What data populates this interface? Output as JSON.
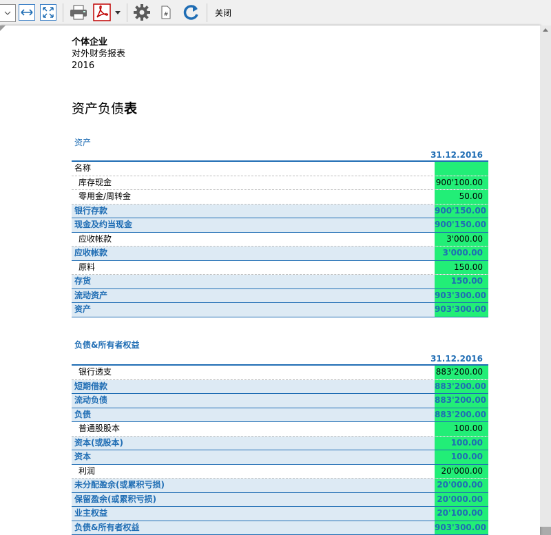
{
  "toolbar": {
    "close_label": "关闭"
  },
  "report": {
    "company": "个体企业",
    "subtitle": "对外财务报表",
    "year": "2016",
    "title_part1": "资产负债",
    "title_part2": "表"
  },
  "assets": {
    "section_label": "资产",
    "date": "31.12.2016",
    "rows": [
      {
        "label": "名称",
        "value": "",
        "kind": "head"
      },
      {
        "label": "库存现金",
        "value": "900'100.00",
        "kind": "sub"
      },
      {
        "label": "零用金/周转金",
        "value": "50.00",
        "kind": "sub"
      },
      {
        "label": "银行存款",
        "value": "900'150.00",
        "kind": "total"
      },
      {
        "label": "现金及约当现金",
        "value": "900'150.00",
        "kind": "total"
      },
      {
        "label": "应收帐款",
        "value": "3'000.00",
        "kind": "sub"
      },
      {
        "label": "应收帐款",
        "value": "3'000.00",
        "kind": "total"
      },
      {
        "label": "原料",
        "value": "150.00",
        "kind": "sub"
      },
      {
        "label": "存货",
        "value": "150.00",
        "kind": "total"
      },
      {
        "label": "流动资产",
        "value": "903'300.00",
        "kind": "total"
      },
      {
        "label": "资产",
        "value": "903'300.00",
        "kind": "total"
      }
    ]
  },
  "liabilities": {
    "section_label": "负债&所有者权益",
    "date": "31.12.2016",
    "rows": [
      {
        "label": "银行透支",
        "value": "883'200.00",
        "kind": "sub"
      },
      {
        "label": "短期借款",
        "value": "883'200.00",
        "kind": "total"
      },
      {
        "label": "流动负债",
        "value": "883'200.00",
        "kind": "total"
      },
      {
        "label": "负债",
        "value": "883'200.00",
        "kind": "total"
      },
      {
        "label": "普通股股本",
        "value": "100.00",
        "kind": "sub"
      },
      {
        "label": "资本(或股本)",
        "value": "100.00",
        "kind": "total"
      },
      {
        "label": "资本",
        "value": "100.00",
        "kind": "total"
      },
      {
        "label": "利润",
        "value": "20'000.00",
        "kind": "sub"
      },
      {
        "label": "未分配盈余(或累积亏损)",
        "value": "20'000.00",
        "kind": "total"
      },
      {
        "label": "保留盈余(或累积亏损)",
        "value": "20'000.00",
        "kind": "total"
      },
      {
        "label": "业主权益",
        "value": "20'100.00",
        "kind": "total"
      },
      {
        "label": "负债&所有者权益",
        "value": "903'300.00",
        "kind": "total"
      }
    ]
  }
}
